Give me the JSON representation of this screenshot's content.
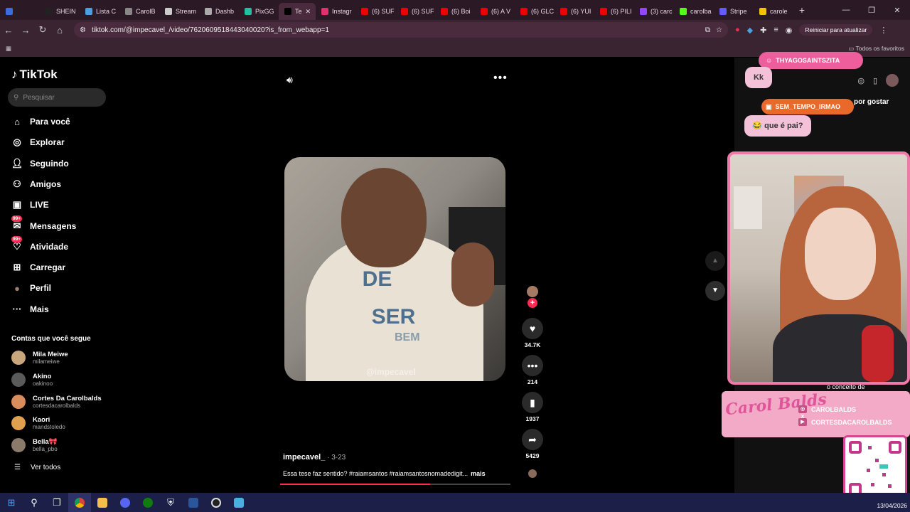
{
  "browser": {
    "tabs": [
      {
        "title": "",
        "color": "#3b6de0"
      },
      {
        "title": "SHEIN",
        "color": "#222"
      },
      {
        "title": "Lista C",
        "color": "#4aa0e0"
      },
      {
        "title": "CarolB",
        "color": "#888"
      },
      {
        "title": "Stream",
        "color": "#ccc"
      },
      {
        "title": "Dashb",
        "color": "#aaa"
      },
      {
        "title": "PixGG",
        "color": "#22c0a0"
      },
      {
        "title": "Te",
        "color": "#000",
        "active": true
      },
      {
        "title": "Instagr",
        "color": "#e1306c"
      },
      {
        "title": "(6) SUF",
        "color": "#e00"
      },
      {
        "title": "(6) SUF",
        "color": "#e00"
      },
      {
        "title": "(6) Boi",
        "color": "#e00"
      },
      {
        "title": "(6) A V",
        "color": "#e00"
      },
      {
        "title": "(6) GLC",
        "color": "#e00"
      },
      {
        "title": "(6) YUI",
        "color": "#e00"
      },
      {
        "title": "(6) PILI",
        "color": "#e00"
      },
      {
        "title": "(3) carc",
        "color": "#9146ff"
      },
      {
        "title": "carolba",
        "color": "#53fc18"
      },
      {
        "title": "Stripe",
        "color": "#635bff"
      },
      {
        "title": "carole",
        "color": "#f5c400"
      }
    ],
    "new_tab": "+",
    "url": "tiktok.com/@impecavel_/video/7620609518443040020?is_from_webapp=1",
    "restart_label": "Reiniciar para atualizar",
    "bookmarks_label": "Todos os favoritos"
  },
  "tiktok": {
    "logo": "TikTok",
    "search_placeholder": "Pesquisar",
    "nav": [
      {
        "label": "Para você",
        "icon": "home-icon"
      },
      {
        "label": "Explorar",
        "icon": "compass-icon"
      },
      {
        "label": "Seguindo",
        "icon": "following-icon"
      },
      {
        "label": "Amigos",
        "icon": "friends-icon"
      },
      {
        "label": "LIVE",
        "icon": "live-icon"
      },
      {
        "label": "Mensagens",
        "icon": "messages-icon",
        "badge": "99+"
      },
      {
        "label": "Atividade",
        "icon": "activity-icon",
        "badge": "99+"
      },
      {
        "label": "Carregar",
        "icon": "upload-icon"
      },
      {
        "label": "Perfil",
        "icon": "profile-icon"
      },
      {
        "label": "Mais",
        "icon": "more-icon"
      }
    ],
    "following_header": "Contas que você segue",
    "accounts": [
      {
        "name": "Mila Meiwe",
        "handle": "milameiwe",
        "color": "#c9a67c"
      },
      {
        "name": "Akino",
        "handle": "oakinoo",
        "color": "#5a5a5a"
      },
      {
        "name": "Cortes Da Carolbalds",
        "handle": "cortesdacarolbalds",
        "color": "#d98d5c"
      },
      {
        "name": "Kaori",
        "handle": "mandstoledo",
        "color": "#e0a050"
      },
      {
        "name": "Bella🎀",
        "handle": "bella_pbo",
        "color": "#8a7a6a"
      }
    ],
    "see_all": "Ver todos",
    "video": {
      "caption_line1": "DE",
      "caption_line2": "SER",
      "caption_line3": "BEM",
      "watermark": "@impecavel",
      "author": "impecavel_",
      "date": " · 3-23",
      "description": "Essa tese faz sentido? #raiamsantos #raiamsantosnomadedigit...",
      "more": "mais",
      "progress": 0.65
    },
    "actions": {
      "likes": "34.7K",
      "comments": "214",
      "saves": "1937",
      "shares": "5429"
    }
  },
  "stream_overlay": {
    "chat": [
      {
        "user": "THYAGOSAINTSZITA",
        "message": "Kk"
      },
      {
        "user": "SEM_TEMPO_IRMAO",
        "message": "😂 que é pai?"
      }
    ],
    "partial_text_1": "por gostar",
    "partial_text_2": "o conceito de",
    "brand": "Carol Balds",
    "socials": [
      {
        "label": "CAROLBALDS",
        "icons": "◎ X"
      },
      {
        "label": "CORTESDACAROLBALDS",
        "icons": "▶"
      }
    ]
  },
  "taskbar": {
    "date": "13/04/2026"
  }
}
